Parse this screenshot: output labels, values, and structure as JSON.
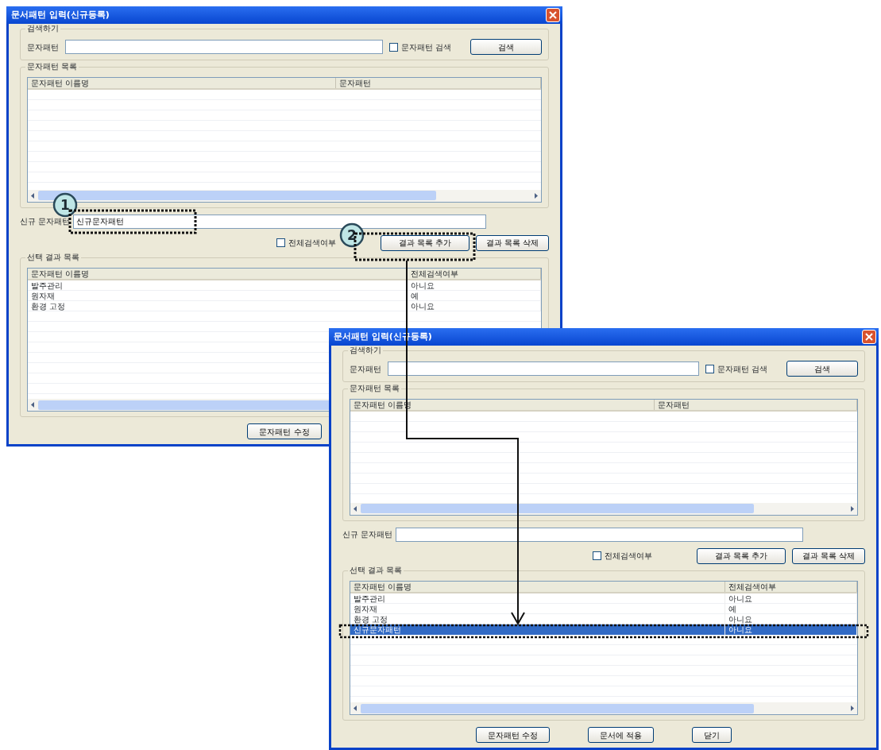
{
  "dialogs": [
    {
      "title": "문서패턴 입력(신규등록)",
      "search": {
        "group": "검색하기",
        "label": "문자패턴",
        "checkbox": {
          "label": "문자패턴 검색",
          "checked": false
        },
        "button": "검색"
      },
      "pattern_list": {
        "group": "문자패턴 목록",
        "columns": [
          "문자패턴 이름명",
          "문자패턴"
        ]
      },
      "new_pattern": {
        "label": "신규 문자패턴",
        "value": "신규문자패턴"
      },
      "whole_search": {
        "label": "전체검색여부",
        "checked": false
      },
      "buttons": [
        "결과 목록 추가",
        "결과 목록 삭제"
      ],
      "result_list": {
        "group": "선택 결과 목록",
        "columns": [
          "문자패턴 이름명",
          "전체검색여부"
        ],
        "rows": [
          {
            "cells": [
              "발주관리",
              "아니요"
            ],
            "selected": false
          },
          {
            "cells": [
              "원자재",
              "예"
            ],
            "selected": false
          },
          {
            "cells": [
              "환경 고정",
              "아니요"
            ],
            "selected": false
          }
        ]
      },
      "footer_buttons": [
        "문자패턴 수정"
      ]
    },
    {
      "title": "문서패턴 입력(신규등록)",
      "search": {
        "group": "검색하기",
        "label": "문자패턴",
        "checkbox": {
          "label": "문자패턴 검색",
          "checked": false
        },
        "button": "검색"
      },
      "pattern_list": {
        "group": "문자패턴 목록",
        "columns": [
          "문자패턴 이름명",
          "문자패턴"
        ]
      },
      "new_pattern": {
        "label": "신규 문자패턴"
      },
      "whole_search": {
        "label": "전체검색여부",
        "checked": false
      },
      "buttons": [
        "결과 목록 추가",
        "결과 목록 삭제"
      ],
      "result_list": {
        "group": "선택 결과 목록",
        "columns": [
          "문자패턴 이름명",
          "전체검색여부"
        ],
        "rows": [
          {
            "cells": [
              "발주관리",
              "아니요"
            ],
            "selected": false
          },
          {
            "cells": [
              "원자재",
              "예"
            ],
            "selected": false
          },
          {
            "cells": [
              "환경 고정",
              "아니요"
            ],
            "selected": false
          },
          {
            "cells": [
              "신규문자패턴",
              "아니요"
            ],
            "selected": true
          }
        ]
      },
      "footer_buttons": [
        "문자패턴 수정",
        "문서에 적용",
        "닫기"
      ]
    }
  ],
  "annotations": [
    {
      "label": "1"
    },
    {
      "label": "2"
    }
  ]
}
